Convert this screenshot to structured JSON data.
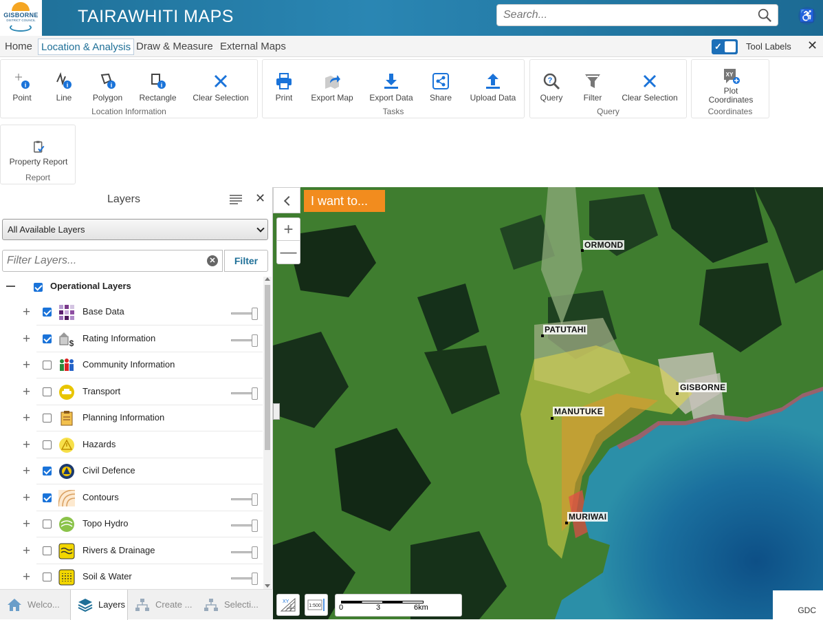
{
  "header": {
    "logo_line1": "GISBORNE",
    "logo_line2": "DISTRICT COUNCIL",
    "title": "TAIRAWHITI MAPS",
    "search_placeholder": "Search..."
  },
  "tabs": [
    {
      "label": "Home",
      "active": false
    },
    {
      "label": "Location & Analysis",
      "active": true
    },
    {
      "label": "Draw & Measure",
      "active": false
    },
    {
      "label": "External Maps",
      "active": false
    }
  ],
  "tool_labels": {
    "label": "Tool Labels",
    "checked": true
  },
  "ribbon": {
    "location_information": {
      "label": "Location Information",
      "tools": [
        "Point",
        "Line",
        "Polygon",
        "Rectangle",
        "Clear Selection"
      ]
    },
    "tasks": {
      "label": "Tasks",
      "tools": [
        "Print",
        "Export Map",
        "Export Data",
        "Share",
        "Upload Data"
      ]
    },
    "query": {
      "label": "Query",
      "tools": [
        "Query",
        "Filter",
        "Clear Selection"
      ]
    },
    "coordinates": {
      "label": "Coordinates",
      "tool_line1": "Plot",
      "tool_line2": "Coordinates"
    },
    "report": {
      "label": "Report",
      "tool": "Property Report"
    }
  },
  "layers_panel": {
    "title": "Layers",
    "selected_set": "All Available Layers",
    "filter_placeholder": "Filter Layers...",
    "filter_button": "Filter",
    "root": {
      "label": "Operational Layers",
      "checked": true
    },
    "layers": [
      {
        "label": "Base Data",
        "checked": true,
        "slider": true,
        "icon": "grid-squares-icon"
      },
      {
        "label": "Rating Information",
        "checked": true,
        "slider": true,
        "icon": "house-dollar-icon"
      },
      {
        "label": "Community Information",
        "checked": false,
        "slider": false,
        "icon": "people-icon"
      },
      {
        "label": "Transport",
        "checked": false,
        "slider": true,
        "icon": "car-icon"
      },
      {
        "label": "Planning Information",
        "checked": false,
        "slider": false,
        "icon": "clipboard-icon"
      },
      {
        "label": "Hazards",
        "checked": false,
        "slider": false,
        "icon": "warning-icon"
      },
      {
        "label": "Civil Defence",
        "checked": true,
        "slider": false,
        "icon": "civil-defence-icon"
      },
      {
        "label": "Contours",
        "checked": true,
        "slider": true,
        "icon": "contour-lines-icon"
      },
      {
        "label": "Topo Hydro",
        "checked": false,
        "slider": true,
        "icon": "topo-hydro-icon"
      },
      {
        "label": "Rivers & Drainage",
        "checked": false,
        "slider": true,
        "icon": "waves-icon"
      },
      {
        "label": "Soil & Water",
        "checked": false,
        "slider": true,
        "icon": "soil-icon"
      }
    ]
  },
  "bottom_tabs": [
    {
      "label": "Welco...",
      "icon": "home-icon",
      "active": false
    },
    {
      "label": "Layers",
      "icon": "layers-icon",
      "active": true
    },
    {
      "label": "Create ...",
      "icon": "hierarchy-icon",
      "active": false
    },
    {
      "label": "Selecti...",
      "icon": "hierarchy-icon",
      "active": false
    }
  ],
  "map": {
    "i_want_to": "I want to...",
    "places": [
      "ORMOND",
      "PATUTAHI",
      "GISBORNE",
      "MANUTUKE",
      "MURIWAI"
    ],
    "scale_ticks": [
      "0",
      "3",
      "6km"
    ],
    "scale_button": "1:500",
    "attribution": "GDC"
  }
}
